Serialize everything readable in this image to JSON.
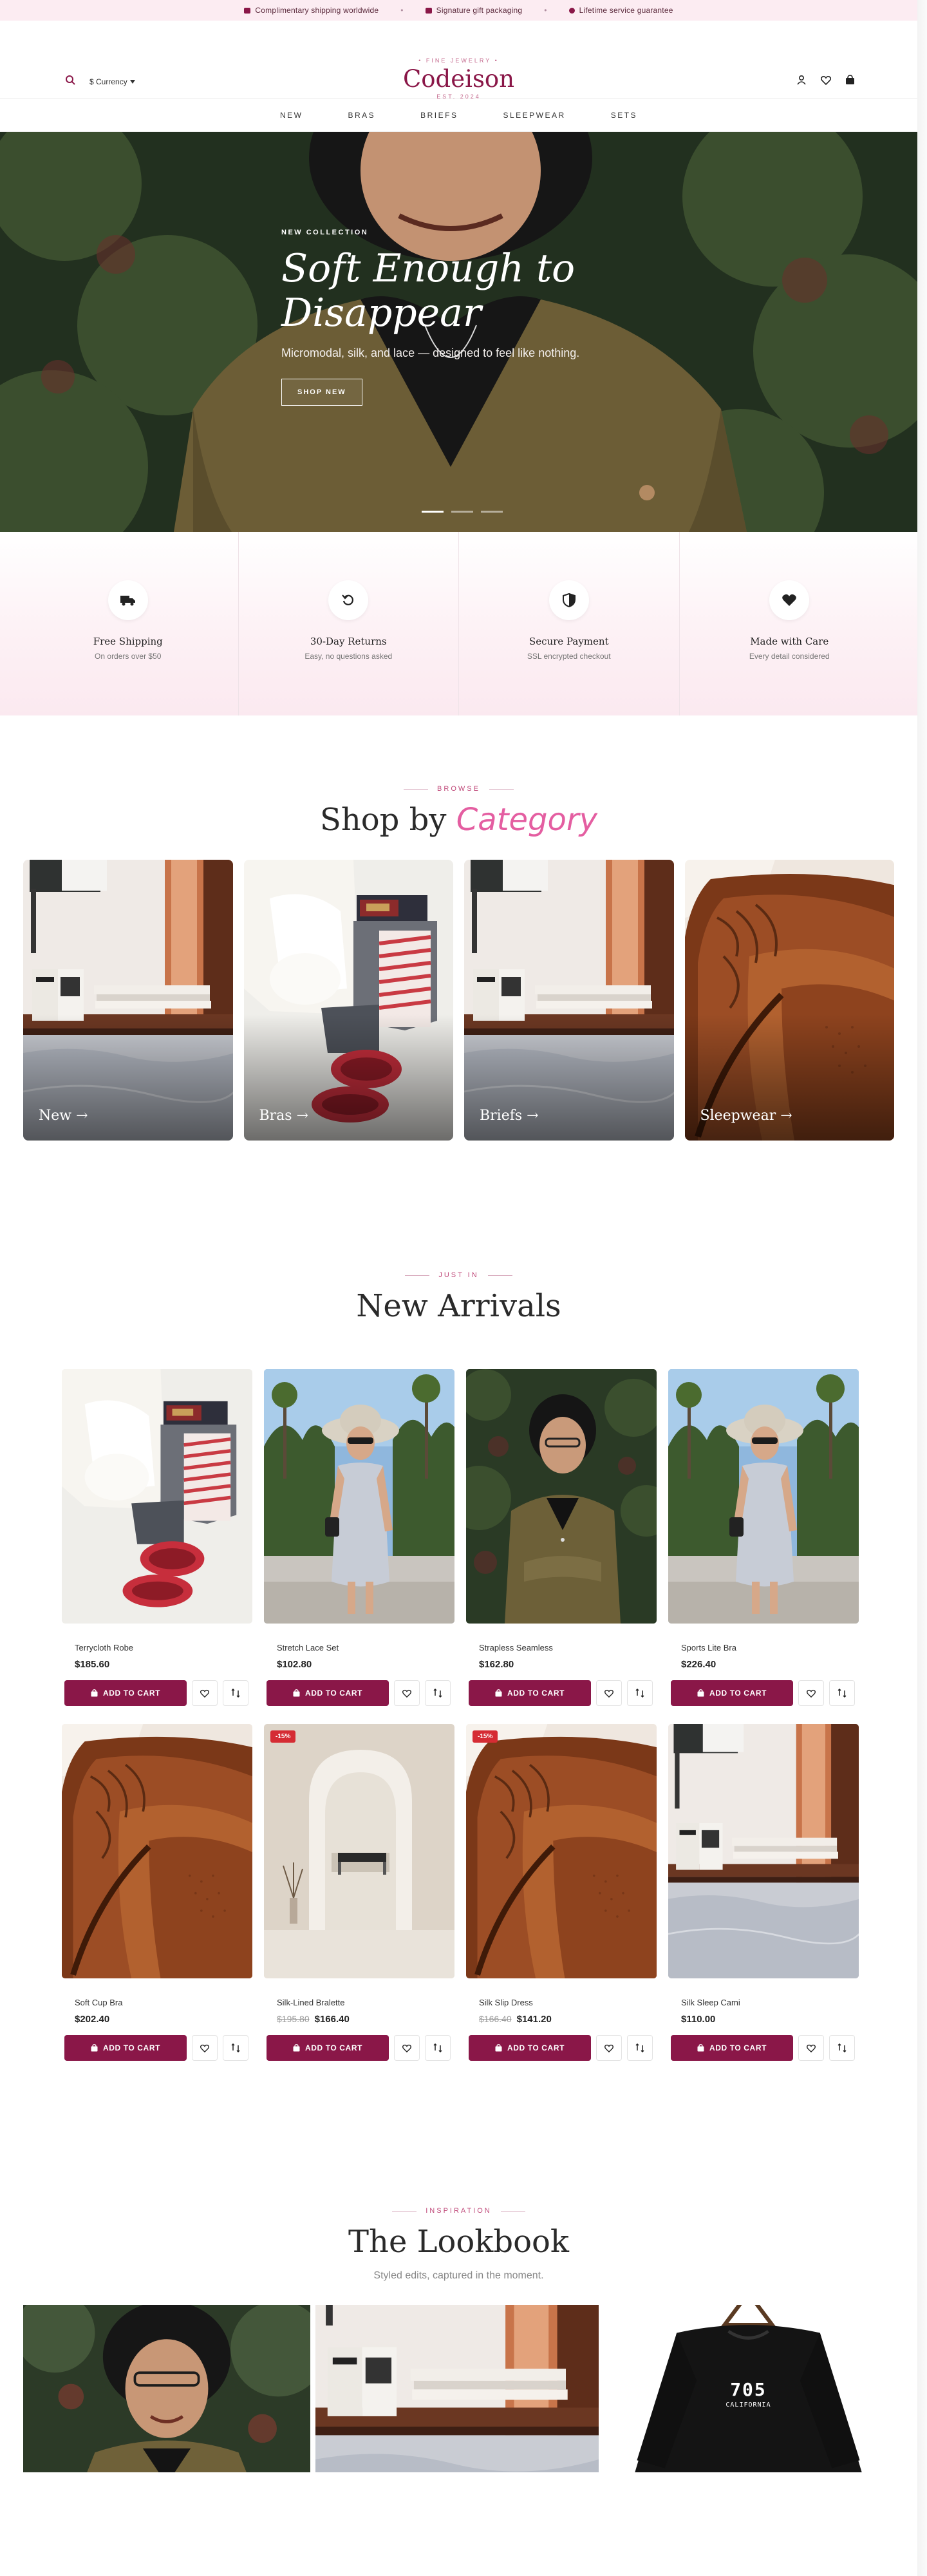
{
  "announcement": {
    "items": [
      "Complimentary shipping worldwide",
      "Signature gift packaging",
      "Lifetime service guarantee"
    ],
    "separator": "•"
  },
  "header": {
    "tagline": "• FINE JEWELRY •",
    "brand": "Codeison",
    "est": "EST. 2024",
    "currency_label": "$ Currency"
  },
  "nav": [
    "NEW",
    "BRAS",
    "BRIEFS",
    "SLEEPWEAR",
    "SETS"
  ],
  "hero": {
    "eyebrow": "NEW COLLECTION",
    "title": "Soft Enough to Disappear",
    "subtitle": "Micromodal, silk, and lace — designed to feel like nothing.",
    "cta": "SHOP NEW",
    "slides": 3,
    "active_slide": 1
  },
  "features": [
    {
      "icon": "truck-icon",
      "title": "Free Shipping",
      "sub": "On orders over $50"
    },
    {
      "icon": "return-icon",
      "title": "30-Day Returns",
      "sub": "Easy, no questions asked"
    },
    {
      "icon": "shield-icon",
      "title": "Secure Payment",
      "sub": "SSL encrypted checkout"
    },
    {
      "icon": "heart-icon",
      "title": "Made with Care",
      "sub": "Every detail considered"
    }
  ],
  "categories": {
    "eyebrow": "BROWSE",
    "title_plain": "Shop by",
    "title_accent": "Category",
    "items": [
      {
        "label": "New →"
      },
      {
        "label": "Bras →"
      },
      {
        "label": "Briefs →"
      },
      {
        "label": "Sleepwear →"
      }
    ]
  },
  "arrivals": {
    "eyebrow": "JUST IN",
    "title": "New Arrivals",
    "add_to_cart": "ADD TO CART",
    "products": [
      {
        "name": "Terrycloth Robe",
        "price": "$185.60",
        "old_price": "",
        "badge": ""
      },
      {
        "name": "Stretch Lace Set",
        "price": "$102.80",
        "old_price": "",
        "badge": ""
      },
      {
        "name": "Strapless Seamless",
        "price": "$162.80",
        "old_price": "",
        "badge": ""
      },
      {
        "name": "Sports Lite Bra",
        "price": "$226.40",
        "old_price": "",
        "badge": ""
      },
      {
        "name": "Soft Cup Bra",
        "price": "$202.40",
        "old_price": "",
        "badge": ""
      },
      {
        "name": "Silk-Lined Bralette",
        "price": "$166.40",
        "old_price": "$195.80",
        "badge": "-15%"
      },
      {
        "name": "Silk Slip Dress",
        "price": "$141.20",
        "old_price": "$166.40",
        "badge": "-15%"
      },
      {
        "name": "Silk Sleep Cami",
        "price": "$110.00",
        "old_price": "",
        "badge": ""
      }
    ]
  },
  "lookbook": {
    "eyebrow": "INSPIRATION",
    "title": "The Lookbook",
    "subtitle": "Styled edits, captured in the moment.",
    "shirt_text_1": "705",
    "shirt_text_2": "CALIFORNIA"
  },
  "colors": {
    "brand": "#8a1748",
    "accent_pink": "#e45ea1",
    "announcement_bg": "#fcecf2",
    "sale_badge": "#d52c34"
  }
}
